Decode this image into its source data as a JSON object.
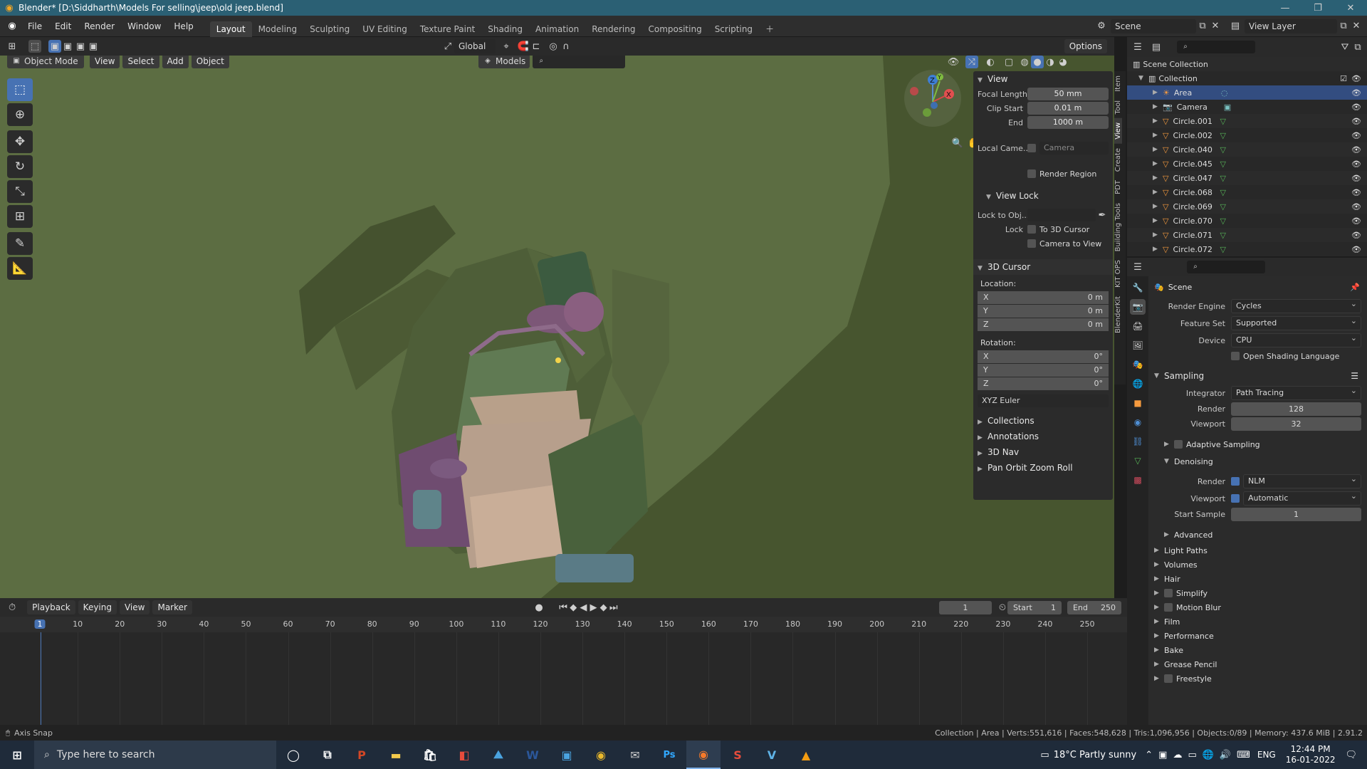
{
  "titlebar": {
    "title": "Blender* [D:\\Siddharth\\Models For selling\\jeep\\old jeep.blend]"
  },
  "menu": [
    "File",
    "Edit",
    "Render",
    "Window",
    "Help"
  ],
  "workspaces": [
    "Layout",
    "Modeling",
    "Sculpting",
    "UV Editing",
    "Texture Paint",
    "Shading",
    "Animation",
    "Rendering",
    "Compositing",
    "Scripting"
  ],
  "scene": {
    "label": "Scene",
    "view_layer": "View Layer"
  },
  "viewport": {
    "orientation": "Global",
    "options": "Options",
    "mode": "Object Mode",
    "menus": [
      "View",
      "Select",
      "Add",
      "Object"
    ],
    "models_label": "Models"
  },
  "vtabs": [
    "Item",
    "Tool",
    "View",
    "Create",
    "PDT",
    "Building Tools",
    "KIT OPS",
    "BlenderKit"
  ],
  "npanel": {
    "view_title": "View",
    "focal_length_label": "Focal Length",
    "focal_length": "50 mm",
    "clip_start_label": "Clip Start",
    "clip_start": "0.01 m",
    "end_label": "End",
    "end": "1000 m",
    "local_camera_label": "Local Came...",
    "local_camera": "Camera",
    "render_region": "Render Region",
    "view_lock_title": "View Lock",
    "lock_to_obj_label": "Lock to Obj...",
    "lock_label": "Lock",
    "to_3d_cursor": "To 3D Cursor",
    "camera_to_view": "Camera to View",
    "cursor_title": "3D Cursor",
    "location_label": "Location:",
    "loc": [
      {
        "axis": "X",
        "value": "0 m"
      },
      {
        "axis": "Y",
        "value": "0 m"
      },
      {
        "axis": "Z",
        "value": "0 m"
      }
    ],
    "rotation_label": "Rotation:",
    "rot": [
      {
        "axis": "X",
        "value": "0°"
      },
      {
        "axis": "Y",
        "value": "0°"
      },
      {
        "axis": "Z",
        "value": "0°"
      }
    ],
    "rotation_mode": "XYZ Euler",
    "collapsed": [
      "Collections",
      "Annotations",
      "3D Nav",
      "Pan Orbit Zoom Roll"
    ]
  },
  "outliner": {
    "scene_collection": "Scene Collection",
    "collection": "Collection",
    "items": [
      "Area",
      "Camera",
      "Circle.001",
      "Circle.002",
      "Circle.040",
      "Circle.045",
      "Circle.047",
      "Circle.068",
      "Circle.069",
      "Circle.070",
      "Circle.071",
      "Circle.072"
    ]
  },
  "props": {
    "scene_label": "Scene",
    "render_engine_label": "Render Engine",
    "render_engine": "Cycles",
    "feature_set_label": "Feature Set",
    "feature_set": "Supported",
    "device_label": "Device",
    "device": "CPU",
    "osl": "Open Shading Language",
    "sampling": "Sampling",
    "integrator_label": "Integrator",
    "integrator": "Path Tracing",
    "render_label": "Render",
    "render_samples": "128",
    "viewport_label": "Viewport",
    "viewport_samples": "32",
    "adaptive": "Adaptive Sampling",
    "denoising": "Denoising",
    "denoise_render": "NLM",
    "denoise_viewport": "Automatic",
    "start_sample_label": "Start Sample",
    "start_sample": "1",
    "advanced": "Advanced",
    "sections": [
      "Light Paths",
      "Volumes",
      "Hair",
      "Simplify",
      "Motion Blur",
      "Film",
      "Performance",
      "Bake",
      "Grease Pencil",
      "Freestyle"
    ]
  },
  "timeline": {
    "menus": [
      "Playback",
      "Keying",
      "View",
      "Marker"
    ],
    "current_frame": "1",
    "start_label": "Start",
    "start": "1",
    "end_label": "End",
    "end": "250",
    "ticks": [
      "1",
      "10",
      "20",
      "30",
      "40",
      "50",
      "60",
      "70",
      "80",
      "90",
      "100",
      "110",
      "120",
      "130",
      "140",
      "150",
      "160",
      "170",
      "180",
      "190",
      "200",
      "210",
      "220",
      "230",
      "240",
      "250"
    ]
  },
  "status": {
    "left": "Axis Snap",
    "right": "Collection | Area | Verts:551,616 | Faces:548,628 | Tris:1,096,956 | Objects:0/89 | Memory: 437.6 MiB | 2.91.2"
  },
  "taskbar": {
    "search": "Type here to search",
    "weather": "18°C  Partly sunny",
    "lang": "ENG",
    "time": "12:44 PM",
    "date": "16-01-2022"
  }
}
